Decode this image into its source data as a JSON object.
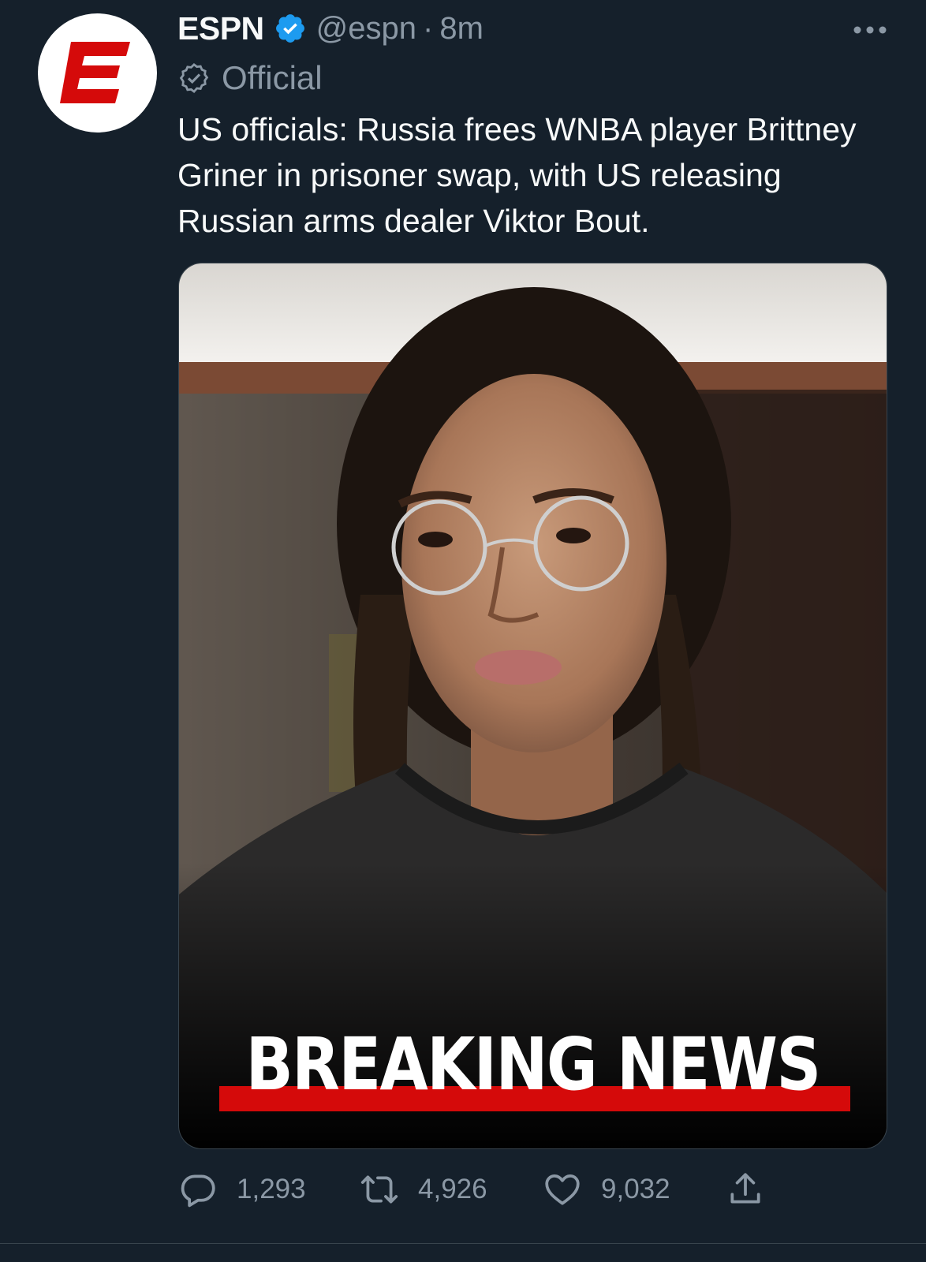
{
  "tweet": {
    "display_name": "ESPN",
    "handle": "@espn",
    "separator": "·",
    "time": "8m",
    "official_label": "Official",
    "text": "US officials: Russia frees WNBA player Brittney Griner in prisoner swap, with US releasing Russian arms dealer Viktor Bout.",
    "media": {
      "overlay_text": "BREAKING NEWS"
    },
    "stats": {
      "replies": "1,293",
      "retweets": "4,926",
      "likes": "9,032"
    }
  },
  "colors": {
    "background": "#15202b",
    "text_primary": "#f7f9f9",
    "text_secondary": "#8b98a5",
    "verified_blue": "#1d9bf0",
    "espn_red": "#d50a0a",
    "divider": "#38444d"
  },
  "icons": {
    "avatar": "espn-logo-icon",
    "verified": "verified-badge-icon",
    "official": "official-badge-icon",
    "more": "more-dots-icon",
    "reply": "reply-icon",
    "retweet": "retweet-icon",
    "like": "heart-icon",
    "share": "share-icon"
  }
}
